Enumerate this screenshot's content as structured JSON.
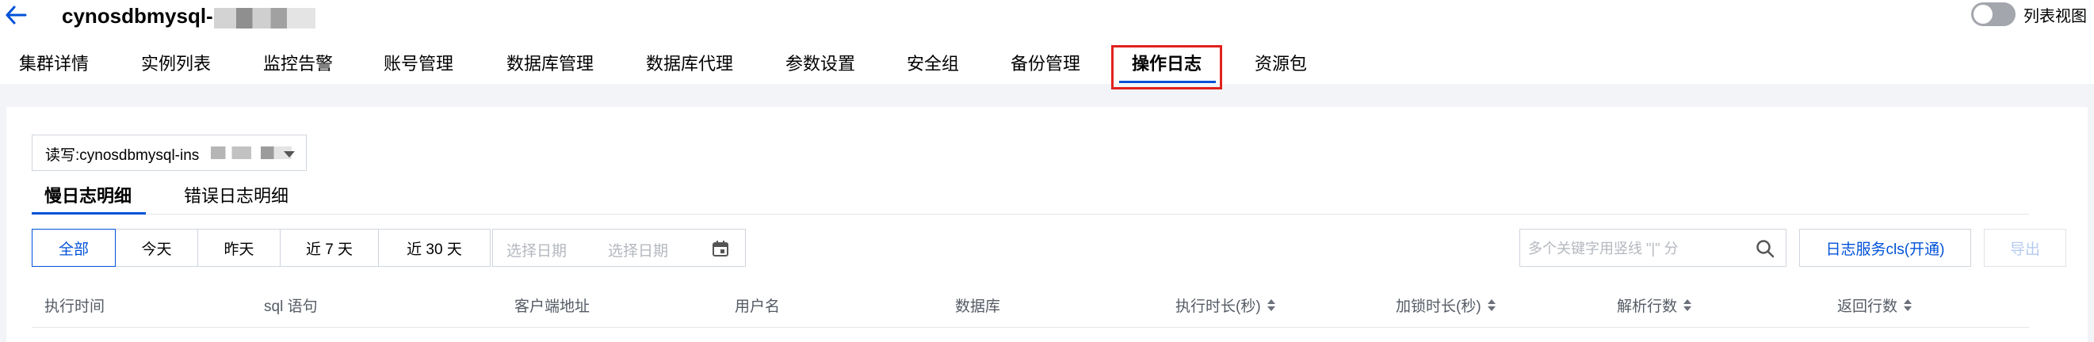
{
  "header": {
    "title": "cynosdbmysql-",
    "list_view_label": "列表视图",
    "list_view_enabled": false
  },
  "tabs": [
    {
      "label": "集群详情",
      "active": false
    },
    {
      "label": "实例列表",
      "active": false
    },
    {
      "label": "监控告警",
      "active": false
    },
    {
      "label": "账号管理",
      "active": false
    },
    {
      "label": "数据库管理",
      "active": false
    },
    {
      "label": "数据库代理",
      "active": false
    },
    {
      "label": "参数设置",
      "active": false
    },
    {
      "label": "安全组",
      "active": false
    },
    {
      "label": "备份管理",
      "active": false
    },
    {
      "label": "操作日志",
      "active": true
    },
    {
      "label": "资源包",
      "active": false
    }
  ],
  "instance_select": {
    "value": "读写:cynosdbmysql-ins"
  },
  "log_tabs": [
    {
      "label": "慢日志明细",
      "active": true
    },
    {
      "label": "错误日志明细",
      "active": false
    }
  ],
  "time_range": {
    "options": [
      "全部",
      "今天",
      "昨天",
      "近 7 天",
      "近 30 天"
    ],
    "selected": "全部"
  },
  "date_picker": {
    "start_placeholder": "选择日期",
    "end_placeholder": "选择日期"
  },
  "search": {
    "placeholder": "多个关键字用竖线 \"|\" 分"
  },
  "buttons": {
    "cls_label": "日志服务cls(开通)",
    "export_label": "导出"
  },
  "table": {
    "columns": [
      {
        "label": "执行时间",
        "sortable": false
      },
      {
        "label": "sql 语句",
        "sortable": false
      },
      {
        "label": "客户端地址",
        "sortable": false
      },
      {
        "label": "用户名",
        "sortable": false
      },
      {
        "label": "数据库",
        "sortable": false
      },
      {
        "label": "执行时长(秒)",
        "sortable": true
      },
      {
        "label": "加锁时长(秒)",
        "sortable": true
      },
      {
        "label": "解析行数",
        "sortable": true
      },
      {
        "label": "返回行数",
        "sortable": true
      }
    ]
  },
  "colors": {
    "accent": "#0052d9",
    "highlight": "#e0211e",
    "page_bg": "#f3f4f7"
  }
}
